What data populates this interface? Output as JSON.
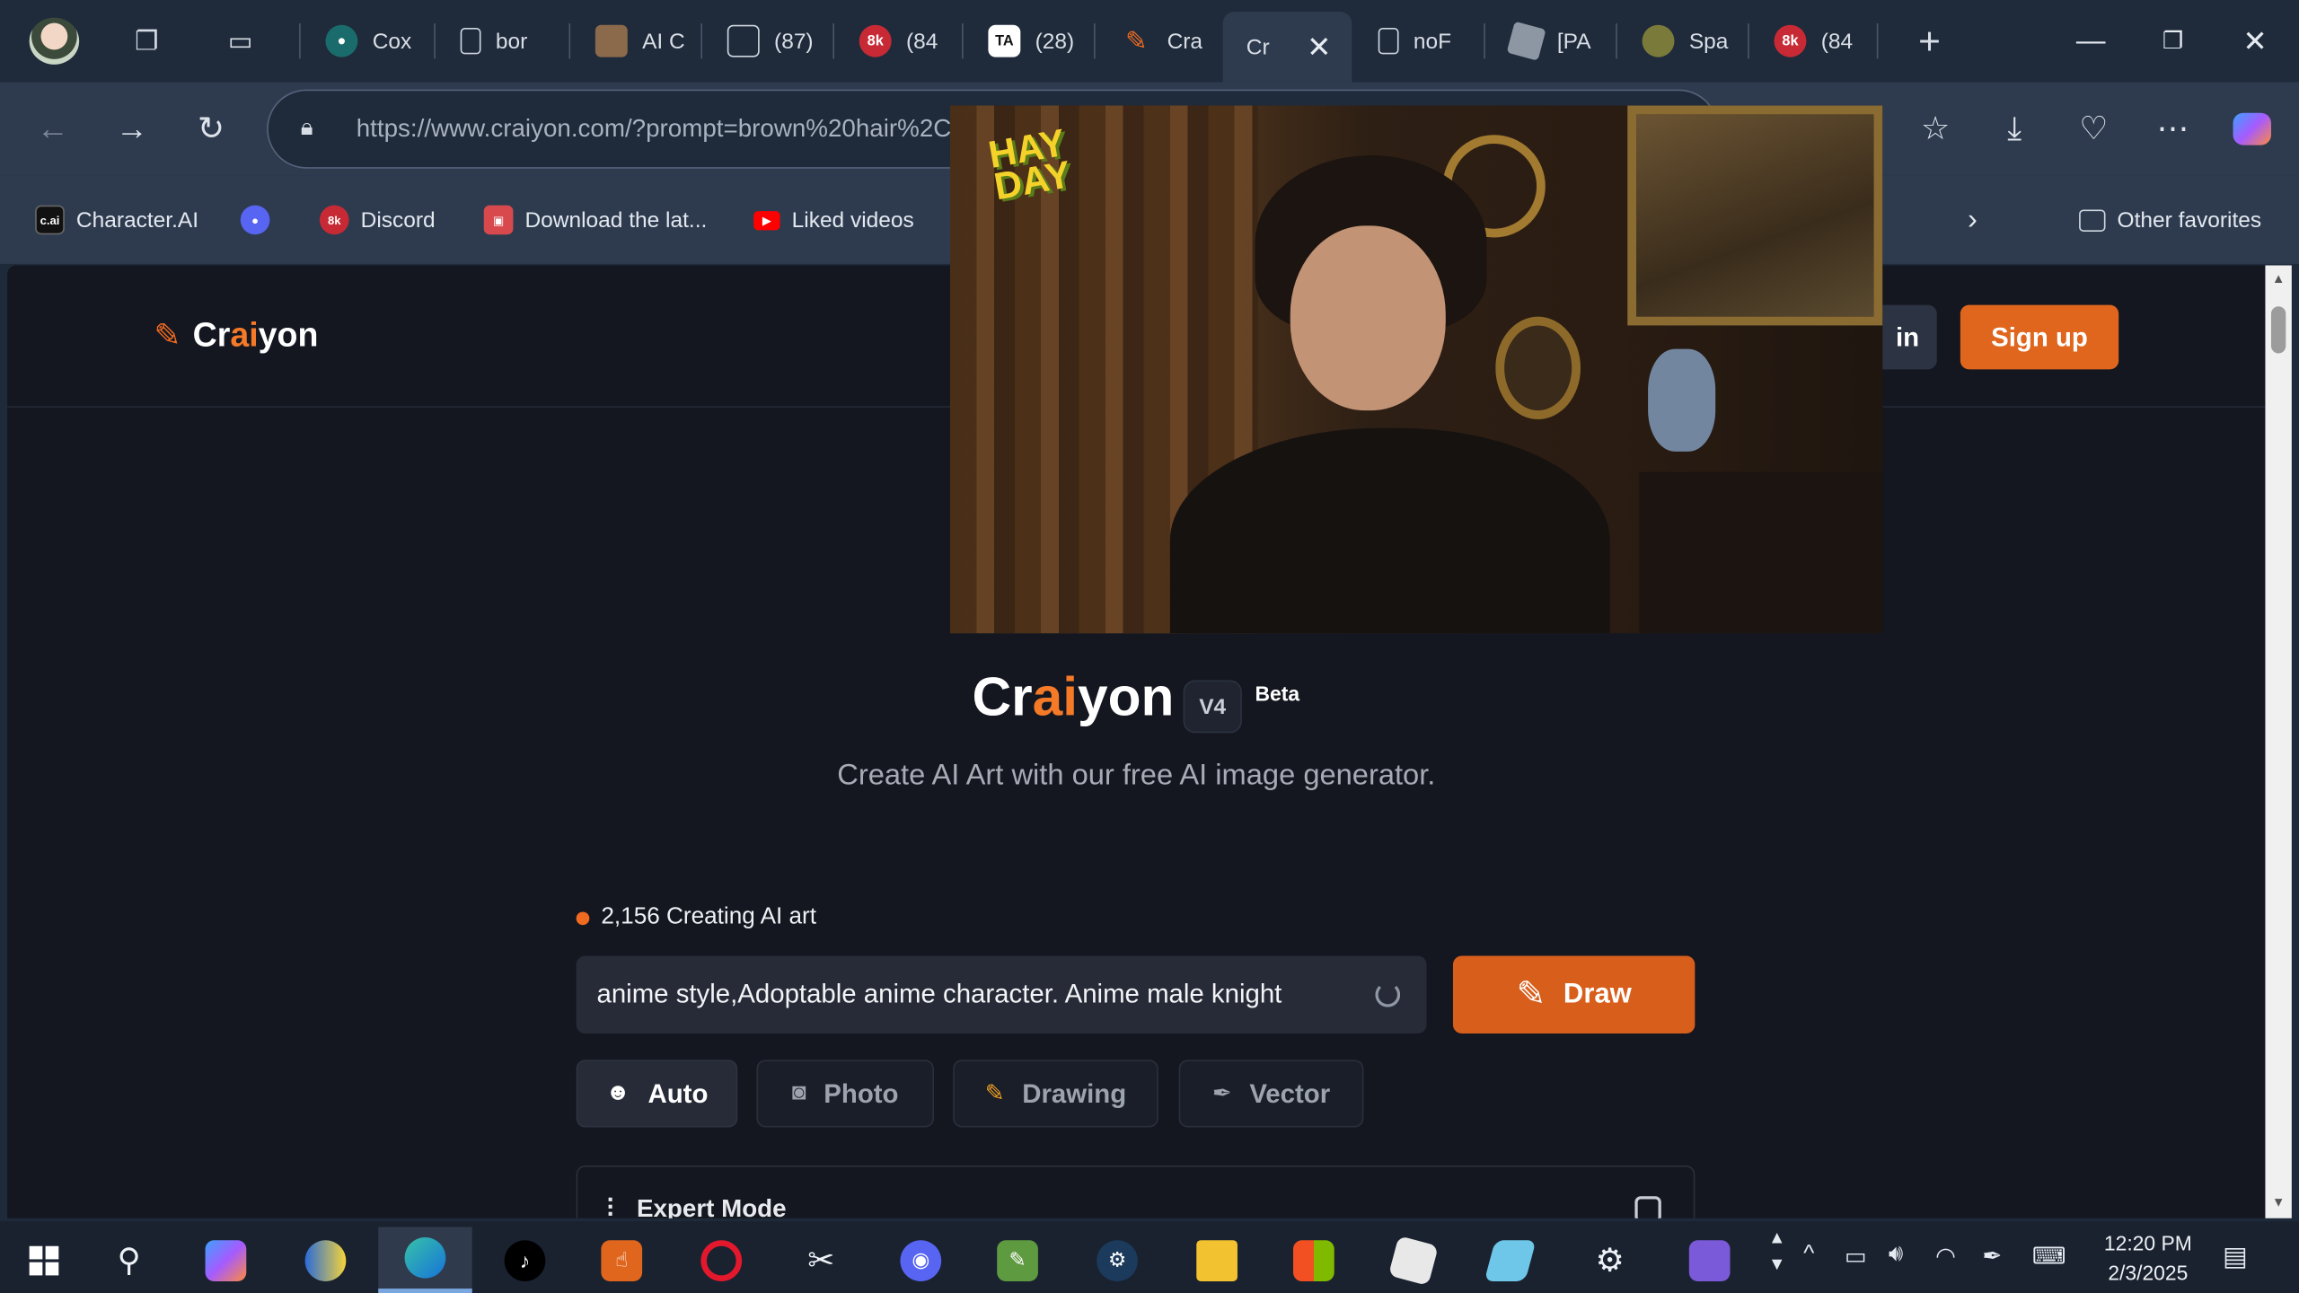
{
  "browser": {
    "tabs": [
      {
        "label": "Cox",
        "icon": "globe-teal-icon"
      },
      {
        "label": "bor",
        "icon": "document-icon"
      },
      {
        "label": "AI C",
        "icon": "character-avatar-icon"
      },
      {
        "label": "(87)",
        "icon": "image-icon"
      },
      {
        "label": "(84",
        "icon": "8k-badge-icon"
      },
      {
        "label": "(28)",
        "icon": "ta-logo-icon"
      },
      {
        "label": "Cra",
        "icon": "pencil-icon"
      },
      {
        "label": "Cr",
        "icon": "none",
        "active": true
      },
      {
        "label": "noF",
        "icon": "document-icon"
      },
      {
        "label": "[PA",
        "icon": "roblox-icon"
      },
      {
        "label": "Spa",
        "icon": "frog-avatar-icon"
      },
      {
        "label": "(84",
        "icon": "8k-badge-icon"
      }
    ],
    "url_domain": "https://www.craiyon.com",
    "url_rest": "/?prompt=brown%20hair%2C",
    "favorites": [
      {
        "label": "Character.AI",
        "icon": "cai-icon"
      },
      {
        "label": "",
        "icon": "discord-icon"
      },
      {
        "label": "Discord",
        "icon": "8k-badge-icon"
      },
      {
        "label": "Download the lat...",
        "icon": "arcade-icon"
      },
      {
        "label": "Liked videos",
        "icon": "youtube-icon"
      }
    ],
    "other_favorites": "Other favorites"
  },
  "site": {
    "brand_pre": "Cr",
    "brand_accent": "ai",
    "brand_post": "yon",
    "login_label": "in",
    "signup_label": "Sign up",
    "hero_title_pre": "Cr",
    "hero_title_accent": "ai",
    "hero_title_post": "yon",
    "version": "V4",
    "beta": "Beta",
    "subtitle": "Create AI Art with our free AI image generator.",
    "status_count": "2,156 Creating AI art",
    "prompt_value": "anime style,Adoptable anime character. Anime male knight",
    "draw_label": "Draw",
    "modes": [
      {
        "label": "Auto",
        "icon": "mask-icon",
        "selected": true
      },
      {
        "label": "Photo",
        "icon": "camera-icon"
      },
      {
        "label": "Drawing",
        "icon": "pencil-icon"
      },
      {
        "label": "Vector",
        "icon": "pen-nib-icon"
      }
    ],
    "expert_label": "Expert Mode"
  },
  "pip": {
    "logo_text": "HAY DAY"
  },
  "taskbar": {
    "time": "12:20 PM",
    "date": "2/3/2025"
  },
  "colors": {
    "accent": "#f47a28",
    "draw_button": "#d75e1b",
    "page_bg": "#141720"
  }
}
